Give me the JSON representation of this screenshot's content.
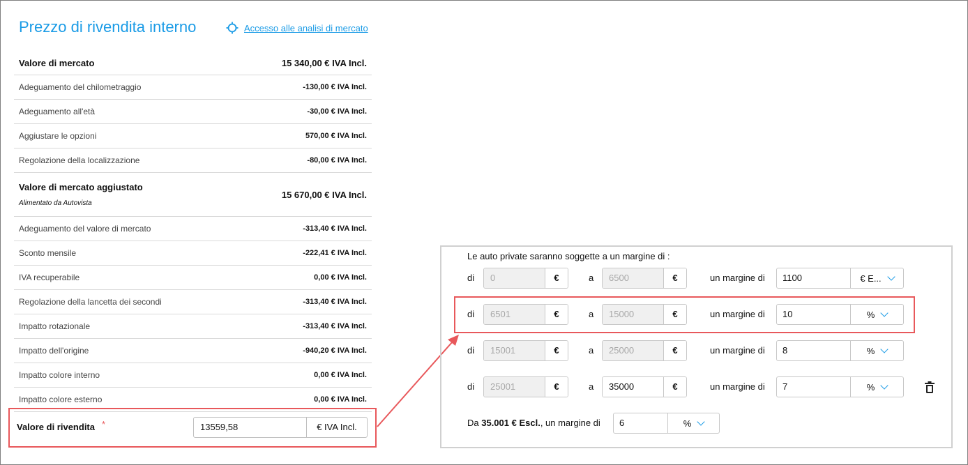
{
  "header": {
    "title": "Prezzo di rivendita interno",
    "market_link": "Accesso alle analisi di mercato"
  },
  "valuation": {
    "market_value": {
      "label": "Valore di mercato",
      "value": "15 340,00 €  IVA Incl."
    },
    "adjustments_a": [
      {
        "label": "Adeguamento del chilometraggio",
        "value": "-130,00 € IVA Incl."
      },
      {
        "label": "Adeguamento all'età",
        "value": "-30,00 € IVA Incl."
      },
      {
        "label": "Aggiustare le opzioni",
        "value": "570,00 € IVA Incl."
      },
      {
        "label": "Regolazione della localizzazione",
        "value": "-80,00 € IVA Incl."
      }
    ],
    "adjusted_value": {
      "label": "Valore di mercato aggiustato",
      "sublabel": "Alimentato da Autovista",
      "value": "15 670,00 €  IVA Incl."
    },
    "adjustments_b": [
      {
        "label": "Adeguamento del valore di mercato",
        "value": "-313,40 € IVA Incl."
      },
      {
        "label": "Sconto mensile",
        "value": "-222,41 € IVA Incl."
      },
      {
        "label": "IVA recuperabile",
        "value": "0,00 € IVA Incl."
      },
      {
        "label": "Regolazione della lancetta dei secondi",
        "value": "-313,40 € IVA Incl."
      },
      {
        "label": "Impatto rotazionale",
        "value": "-313,40 € IVA Incl."
      },
      {
        "label": "Impatto dell'origine",
        "value": "-940,20 € IVA Incl."
      },
      {
        "label": "Impatto colore interno",
        "value": "0,00 € IVA Incl."
      },
      {
        "label": "Impatto colore esterno",
        "value": "0,00 € IVA Incl."
      }
    ],
    "resale": {
      "label": "Valore di rivendita",
      "required_mark": "*",
      "value": "13559,58",
      "unit": "€ IVA Incl."
    }
  },
  "margins": {
    "title": "Le auto private saranno soggette a un margine di :",
    "from_label": "di",
    "to_label": "a",
    "margin_label": "un margine di",
    "currency": "€",
    "rows": [
      {
        "from": "0",
        "to": "6500",
        "margin": "1100",
        "unit": "€ E..."
      },
      {
        "from": "6501",
        "to": "15000",
        "margin": "10",
        "unit": "%"
      },
      {
        "from": "15001",
        "to": "25000",
        "margin": "8",
        "unit": "%"
      },
      {
        "from": "25001",
        "to": "35000",
        "margin": "7",
        "unit": "%"
      }
    ],
    "final": {
      "prefix": "Da ",
      "amount": "35.001 € Escl.",
      "suffix": ", un margine di",
      "margin": "6",
      "unit": "%"
    }
  },
  "colors": {
    "accent": "#1a9be6",
    "highlight": "#e8585b"
  }
}
